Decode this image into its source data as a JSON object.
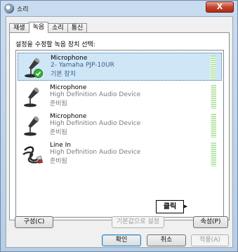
{
  "window": {
    "title": "소리",
    "close_label": "X"
  },
  "tabs": [
    {
      "label": "재생"
    },
    {
      "label": "녹음",
      "active": true
    },
    {
      "label": "소리"
    },
    {
      "label": "통신"
    }
  ],
  "panel": {
    "instruction": "설정을 수정할 녹음 장치 선택:"
  },
  "devices": [
    {
      "name": "Microphone",
      "description": "2- Yamaha PJP-10UR",
      "status": "기본 장치",
      "icon": "microphone-icon",
      "selected": true,
      "default_badge": "green-check-icon"
    },
    {
      "name": "Microphone",
      "description": "High Definition Audio Device",
      "status": "준비됨",
      "icon": "microphone-icon"
    },
    {
      "name": "Microphone",
      "description": "High Definition Audio Device",
      "status": "준비됨",
      "icon": "microphone-icon"
    },
    {
      "name": "Line In",
      "description": "High Definition Audio Device",
      "status": "준비됨",
      "icon": "line-in-cable-icon"
    }
  ],
  "buttons": {
    "configure": "구성(C)",
    "set_default": "기본값으로 설정",
    "properties": "속성(P)",
    "ok": "확인",
    "cancel": "취소",
    "apply": "적용(A)"
  },
  "annotation": {
    "label": "클릭"
  }
}
